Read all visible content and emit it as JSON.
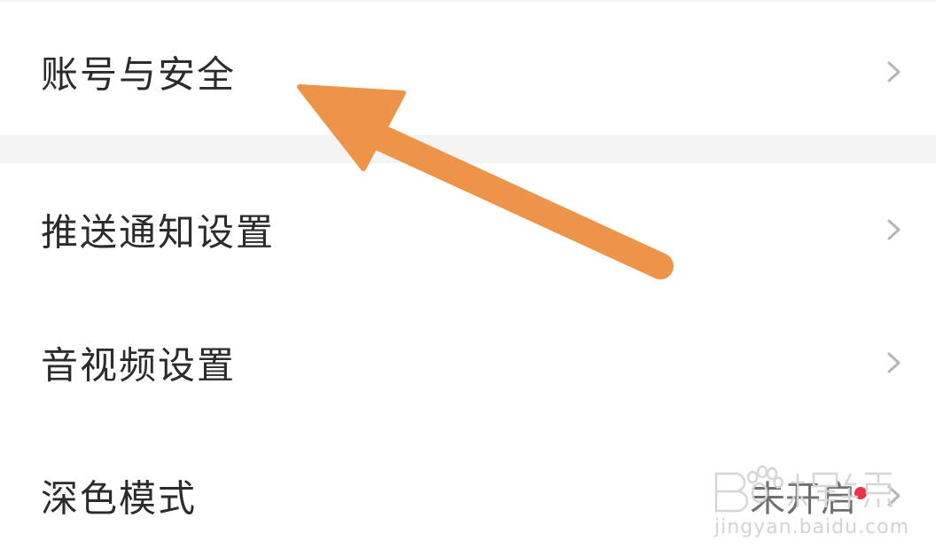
{
  "settings_list": {
    "items": [
      {
        "label": "账号与安全"
      },
      {
        "label": "推送通知设置"
      },
      {
        "label": "音视频设置"
      },
      {
        "label": "深色模式",
        "value": "未开启"
      }
    ]
  },
  "annotation": {
    "arrow_color": "#EE9448"
  },
  "watermark": {
    "logo_text": "Bai度经验",
    "url": "jingyan.baidu.com"
  },
  "colors": {
    "background": "#ffffff",
    "section_gap": "#f4f4f4",
    "label_text": "#2b2b2b",
    "chevron": "#b5b5b5",
    "badge_dot": "#e8334a"
  }
}
